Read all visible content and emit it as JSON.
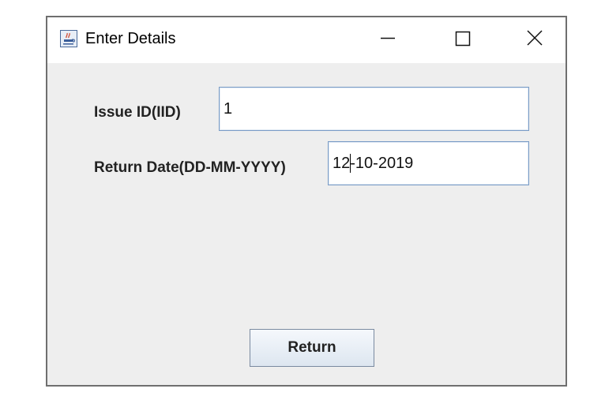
{
  "window": {
    "title": "Enter Details",
    "app_icon": "java-coffee-cup-icon",
    "controls": {
      "minimize_icon": "minimize-icon",
      "maximize_icon": "maximize-icon",
      "close_icon": "close-icon"
    }
  },
  "form": {
    "issue_id": {
      "label": "Issue ID(IID)",
      "value": "1"
    },
    "return_date": {
      "label": "Return Date(DD-MM-YYYY)",
      "value_before_caret": "12",
      "value_after_caret": "-10-2019"
    },
    "return_button": {
      "label": "Return"
    }
  },
  "colors": {
    "window_bg": "#eeeeee",
    "titlebar_bg": "#ffffff",
    "field_border": "#7a9cc6",
    "button_border": "#7a8aa0"
  }
}
